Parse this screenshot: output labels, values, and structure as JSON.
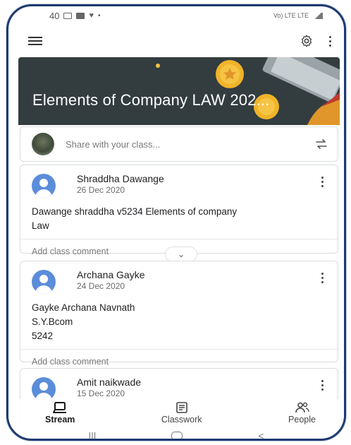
{
  "status_bar": {
    "left_text": "40",
    "right_text": "Vo) LTE LTE"
  },
  "class": {
    "title": "Elements of Company LAW 202..."
  },
  "share": {
    "placeholder": "Share with your class..."
  },
  "posts": [
    {
      "author": "Shraddha Dawange",
      "date": "26 Dec 2020",
      "lines": [
        "Dawange shraddha v5234 Elements of company",
        "Law"
      ],
      "comment_placeholder": "Add class comment"
    },
    {
      "author": "Archana Gayke",
      "date": "24 Dec 2020",
      "lines": [
        "Gayke Archana Navnath",
        "S.Y.Bcom",
        "5242"
      ],
      "comment_placeholder": "Add class comment"
    },
    {
      "author": "Amit naikwade",
      "date": "15 Dec 2020"
    }
  ],
  "bottom_nav": {
    "stream": "Stream",
    "classwork": "Classwork",
    "people": "People",
    "active": "stream"
  },
  "colors": {
    "banner_bg": "#333d40",
    "avatar_blue": "#5b8dd9",
    "frame_border": "#1e3a70"
  },
  "icons": {
    "menu": "hamburger-icon",
    "settings": "gear-icon",
    "more": "kebab-icon",
    "repost": "repeat-icon",
    "stream": "stream-icon",
    "classwork": "classwork-icon",
    "people": "people-icon"
  }
}
